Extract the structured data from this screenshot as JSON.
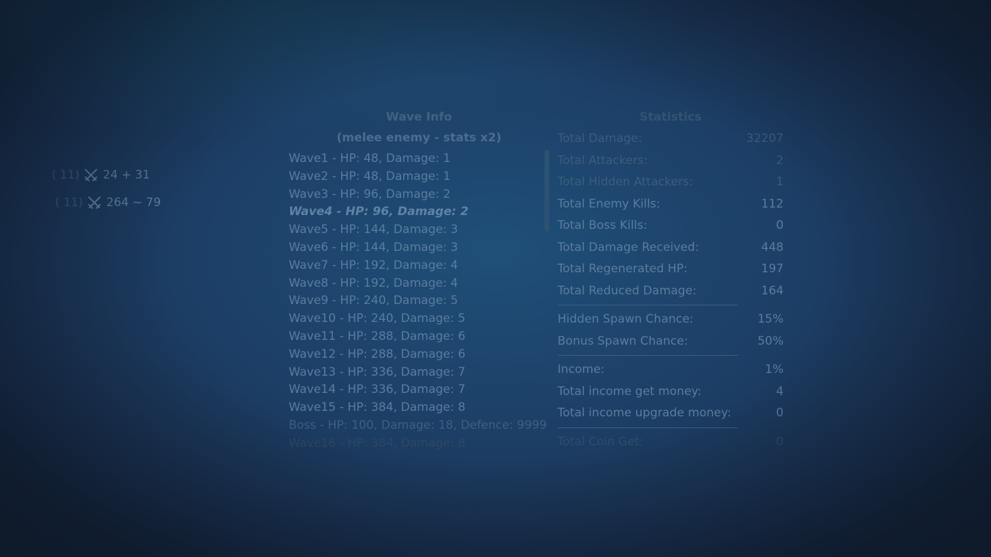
{
  "units": [
    {
      "level": "( 11)",
      "stat": "24 + 31",
      "icon": "crossed-swords-icon"
    },
    {
      "level": "( 11)",
      "stat": "264 ~ 79",
      "icon": "crossed-swords-icon"
    }
  ],
  "wave_info": {
    "title": "Wave Info",
    "subtitle": "(melee enemy - stats x2)",
    "waves": [
      "Wave1 - HP: 48, Damage: 1",
      "Wave2 - HP: 48, Damage: 1",
      "Wave3 - HP: 96, Damage: 2",
      "Wave4 - HP: 96, Damage: 2",
      "Wave5 - HP: 144, Damage: 3",
      "Wave6 - HP: 144, Damage: 3",
      "Wave7 - HP: 192, Damage: 4",
      "Wave8 - HP: 192, Damage: 4",
      "Wave9 - HP: 240, Damage: 5",
      "Wave10 - HP: 240, Damage: 5",
      "Wave11 - HP: 288, Damage: 6",
      "Wave12 - HP: 288, Damage: 6",
      "Wave13 - HP: 336, Damage: 7",
      "Wave14 - HP: 336, Damage: 7",
      "Wave15 - HP: 384, Damage: 8",
      "Boss - HP: 100, Damage: 18, Defence: 9999",
      "Wave16 - HP: 384, Damage: 8"
    ],
    "current_wave_index": 3
  },
  "statistics": {
    "title": "Statistics",
    "group1": [
      {
        "label": "Total Damage:",
        "value": "32207"
      },
      {
        "label": "Total Attackers:",
        "value": "2"
      },
      {
        "label": "Total Hidden Attackers:",
        "value": "1"
      },
      {
        "label": "Total Enemy Kills:",
        "value": "112"
      },
      {
        "label": "Total Boss Kills:",
        "value": "0"
      },
      {
        "label": "Total Damage Received:",
        "value": "448"
      },
      {
        "label": "Total Regenerated HP:",
        "value": "197"
      },
      {
        "label": "Total Reduced Damage:",
        "value": "164"
      }
    ],
    "group2": [
      {
        "label": "Hidden Spawn Chance:",
        "value": "15%"
      },
      {
        "label": "Bonus Spawn Chance:",
        "value": "50%"
      }
    ],
    "group3": [
      {
        "label": "Income:",
        "value": "1%"
      },
      {
        "label": "Total income get money:",
        "value": "4"
      },
      {
        "label": "Total income upgrade money:",
        "value": "0"
      }
    ],
    "group4": [
      {
        "label": "Total Coin Get:",
        "value": "0"
      }
    ]
  }
}
